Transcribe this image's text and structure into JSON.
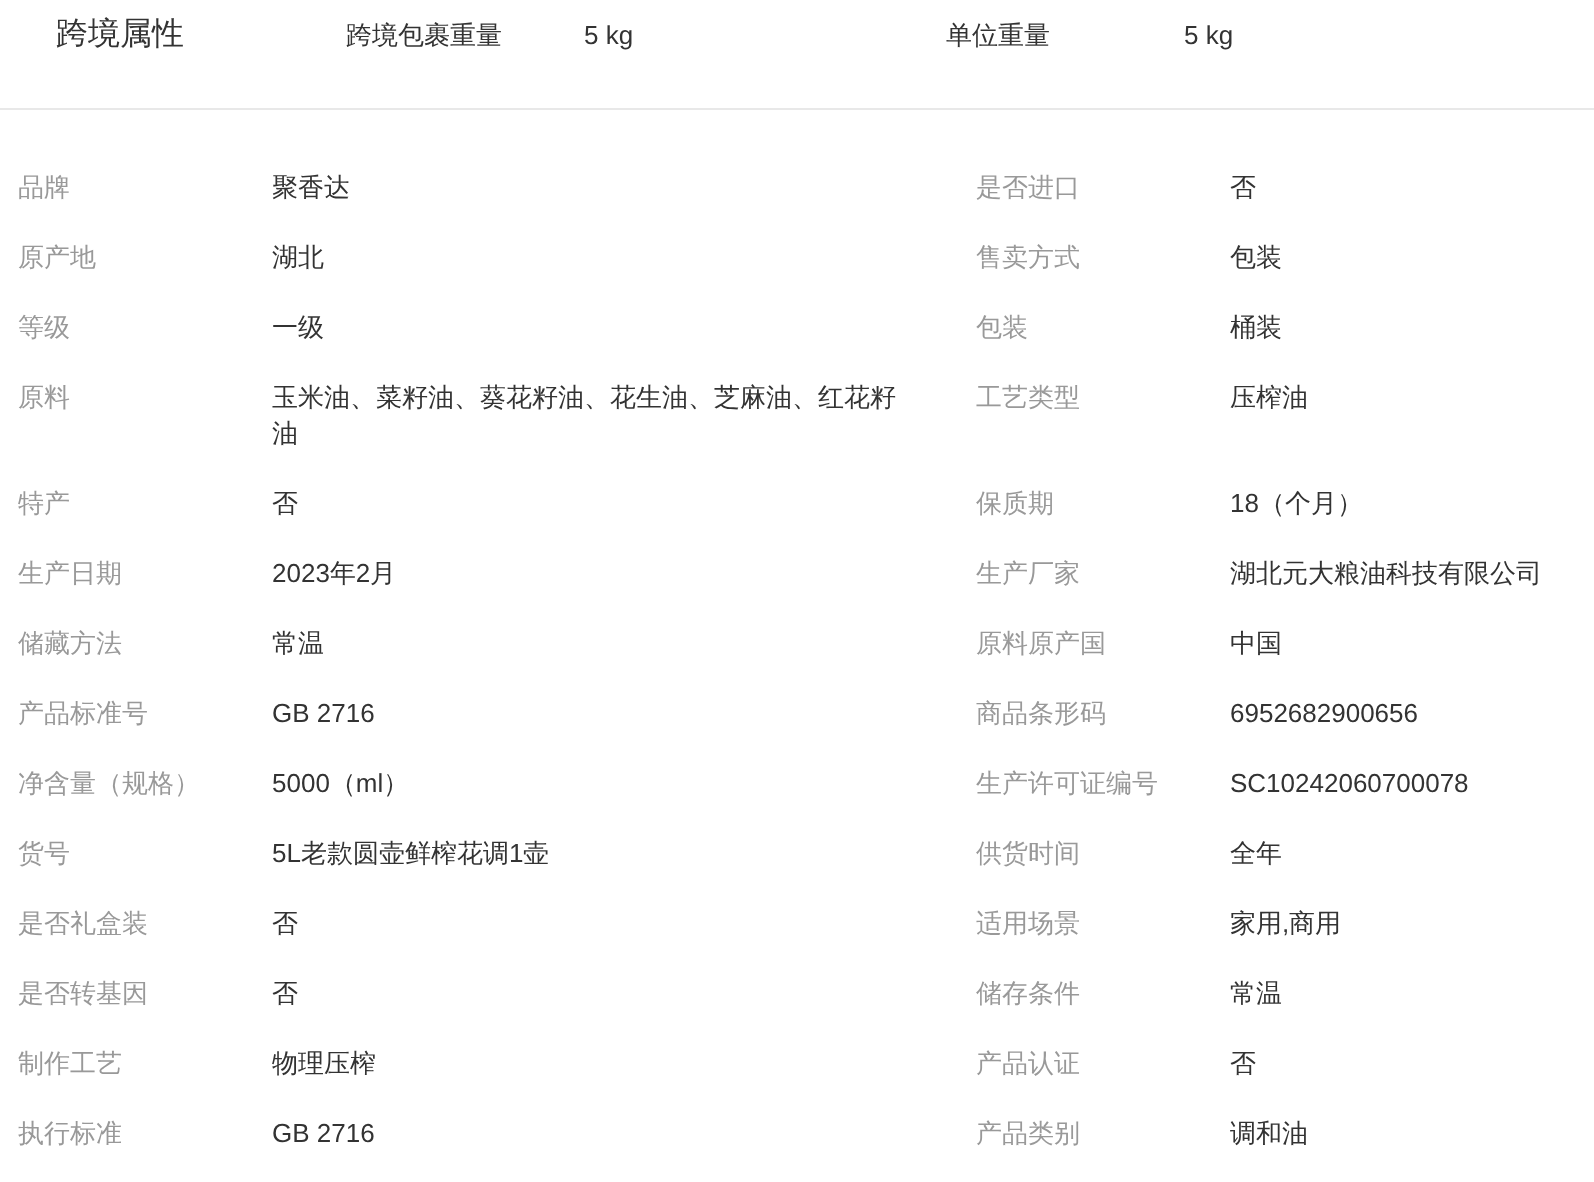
{
  "header": {
    "title": "跨境属性",
    "fields": [
      {
        "label": "跨境包裹重量",
        "value": "5 kg"
      },
      {
        "label": "单位重量",
        "value": "5 kg"
      }
    ]
  },
  "attributes": [
    {
      "label": "品牌",
      "value": "聚香达"
    },
    {
      "label": "是否进口",
      "value": "否"
    },
    {
      "label": "原产地",
      "value": "湖北"
    },
    {
      "label": "售卖方式",
      "value": "包装"
    },
    {
      "label": "等级",
      "value": "一级"
    },
    {
      "label": "包装",
      "value": "桶装"
    },
    {
      "label": "原料",
      "value": "玉米油、菜籽油、葵花籽油、花生油、芝麻油、红花籽油"
    },
    {
      "label": "工艺类型",
      "value": "压榨油"
    },
    {
      "label": "特产",
      "value": "否"
    },
    {
      "label": "保质期",
      "value": "18（个月）"
    },
    {
      "label": "生产日期",
      "value": "2023年2月"
    },
    {
      "label": "生产厂家",
      "value": "湖北元大粮油科技有限公司"
    },
    {
      "label": "储藏方法",
      "value": "常温"
    },
    {
      "label": "原料原产国",
      "value": "中国"
    },
    {
      "label": "产品标准号",
      "value": "GB 2716"
    },
    {
      "label": "商品条形码",
      "value": "6952682900656"
    },
    {
      "label": "净含量（规格）",
      "value": "5000（ml）"
    },
    {
      "label": "生产许可证编号",
      "value": "SC10242060700078"
    },
    {
      "label": "货号",
      "value": "5L老款圆壶鲜榨花调1壶"
    },
    {
      "label": "供货时间",
      "value": "全年"
    },
    {
      "label": "是否礼盒装",
      "value": "否"
    },
    {
      "label": "适用场景",
      "value": "家用,商用"
    },
    {
      "label": "是否转基因",
      "value": "否"
    },
    {
      "label": "储存条件",
      "value": "常温"
    },
    {
      "label": "制作工艺",
      "value": "物理压榨"
    },
    {
      "label": "产品认证",
      "value": "否"
    },
    {
      "label": "执行标准",
      "value": "GB 2716"
    },
    {
      "label": "产品类别",
      "value": "调和油"
    }
  ]
}
